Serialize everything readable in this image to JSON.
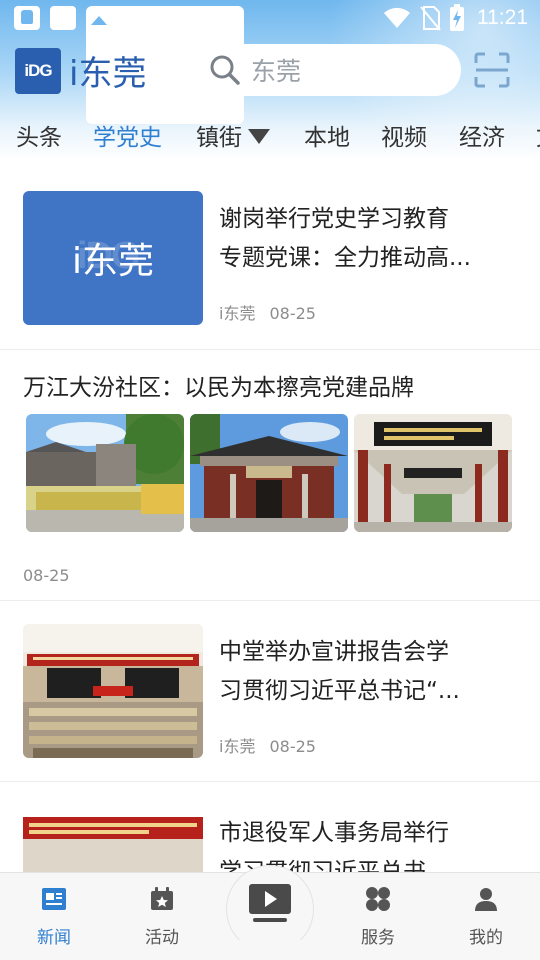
{
  "status_bar": {
    "time": "11:21",
    "left_icons": [
      "hand-icon",
      "square-icon",
      "image-icon"
    ],
    "right_icons": [
      "wifi-icon",
      "no-sim-icon",
      "battery-charging-icon"
    ]
  },
  "app_bar": {
    "logo_mark": "iDG",
    "logo_text": "i东莞",
    "search_placeholder": "东莞",
    "scan_icon": "scan-icon"
  },
  "tabs": {
    "items": [
      {
        "label": "头条",
        "active": false
      },
      {
        "label": "学党史",
        "active": true
      },
      {
        "label": "镇街",
        "active": false,
        "dropdown": true
      },
      {
        "label": "本地",
        "active": false
      },
      {
        "label": "视频",
        "active": false
      },
      {
        "label": "经济",
        "active": false
      },
      {
        "label": "文",
        "active": false
      }
    ]
  },
  "feed": {
    "items": [
      {
        "type": "thumb-right",
        "thumb_text": "i东莞",
        "thumb_ghost": "iDG",
        "title_line1": "谢岗举行党史学习教育",
        "title_line2": "专题党课：全力推动高...",
        "source": "i东莞",
        "date": "08-25"
      },
      {
        "type": "three-photos",
        "title": "万江大汾社区：以民为本擦亮党建品牌",
        "date": "08-25"
      },
      {
        "type": "thumb-right",
        "title_line1": "中堂举办宣讲报告会学",
        "title_line2": "习贯彻习近平总书记“...",
        "source": "i东莞",
        "date": "08-25"
      },
      {
        "type": "thumb-right",
        "title_line1": "市退役军人事务局举行",
        "title_line2": "学习贯彻习近平总书"
      }
    ]
  },
  "bottom_nav": {
    "items": [
      {
        "label": "新闻",
        "icon": "news-icon",
        "active": true
      },
      {
        "label": "活动",
        "icon": "calendar-icon",
        "active": false
      },
      {
        "label": "",
        "icon": "video-play-icon",
        "active": false
      },
      {
        "label": "服务",
        "icon": "services-grid-icon",
        "active": false
      },
      {
        "label": "我的",
        "icon": "user-icon",
        "active": false
      }
    ]
  },
  "colors": {
    "accent": "#2f7fd0",
    "brand": "#2a5fb0",
    "header_top": "#6fb7ee"
  }
}
